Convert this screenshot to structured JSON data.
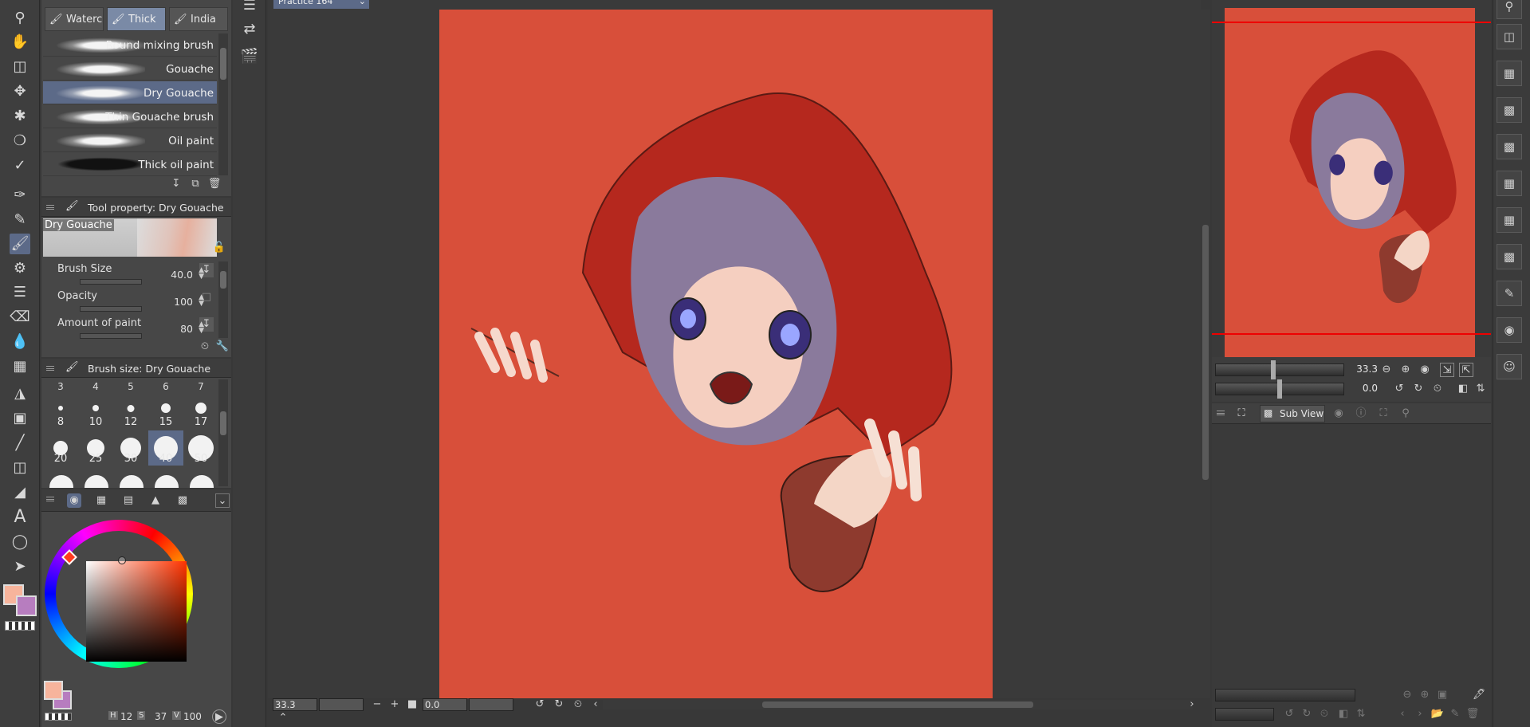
{
  "document": {
    "tab_title": "Practice 164"
  },
  "brush_tabs": [
    "Waterc",
    "Thick p",
    "India in"
  ],
  "brush_list": [
    {
      "name": "Round mixing brush",
      "selected": false
    },
    {
      "name": "Gouache",
      "selected": false
    },
    {
      "name": "Dry Gouache",
      "selected": true
    },
    {
      "name": "Thin Gouache brush",
      "selected": false
    },
    {
      "name": "Oil paint",
      "selected": false
    },
    {
      "name": "Thick oil paint",
      "selected": false
    }
  ],
  "tool_property": {
    "title": "Tool property: Dry Gouache",
    "preview_label": "Dry Gouache",
    "rows": [
      {
        "label": "Brush Size",
        "value": "40.0"
      },
      {
        "label": "Opacity",
        "value": "100"
      },
      {
        "label": "Amount of paint",
        "value": "80"
      }
    ]
  },
  "brush_size_panel": {
    "title": "Brush size: Dry Gouache",
    "top_partial": [
      "3",
      "4",
      "5",
      "6",
      "7"
    ],
    "rows": [
      [
        "8",
        "10",
        "12",
        "15",
        "17"
      ],
      [
        "20",
        "25",
        "30",
        "40",
        "50"
      ]
    ],
    "selected": "40"
  },
  "color": {
    "main": "#f7b49c",
    "sub": "#b77dbf",
    "hsv": {
      "h_label": "H",
      "h": "12",
      "s_label": "S",
      "s": "37",
      "v_label": "V",
      "v": "100"
    }
  },
  "canvas": {
    "background": "#d84f3a"
  },
  "bottom_bar": {
    "zoom": "33.3",
    "rotation": "0.0"
  },
  "navigator": {
    "zoom": "33.3",
    "rotation": "0.0"
  },
  "subview": {
    "tab_label": "Sub View"
  }
}
